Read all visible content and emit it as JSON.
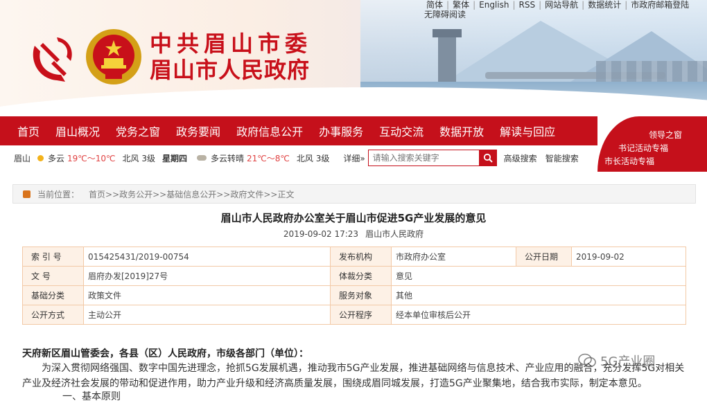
{
  "toplinks": {
    "items": [
      "简体",
      "繁体",
      "English",
      "RSS",
      "网站导航",
      "数据统计",
      "市政府邮箱登陆"
    ],
    "accessibility": "无障碍阅读"
  },
  "header": {
    "line1": "中共眉山市委",
    "line2": "眉山市人民政府"
  },
  "nav": {
    "items": [
      "首页",
      "眉山概况",
      "党务之窗",
      "政务要闻",
      "政府信息公开",
      "办事服务",
      "互动交流",
      "数据开放",
      "解读与回应"
    ]
  },
  "side_links": [
    "领导之窗",
    "书记活动专福",
    "市长活动专福"
  ],
  "weather": {
    "city": "眉山",
    "today": {
      "cond": "多云",
      "temp": "19℃～10℃",
      "wind": "北风 3级"
    },
    "day": "星期四",
    "tomorrow": {
      "cond": "多云转晴",
      "temp": "21℃～8℃",
      "wind": "北风 3级"
    },
    "detail": "详细»"
  },
  "search": {
    "placeholder": "请输入搜索关键字",
    "advanced": "高级搜索",
    "smart": "智能搜索"
  },
  "breadcrumb": {
    "label": "当前位置：",
    "path": "首页>>政务公开>>基础信息公开>>政府文件>>正文"
  },
  "article": {
    "title": "眉山市人民政府办公室关于眉山市促进5G产业发展的意见",
    "date": "2019-09-02 17:23",
    "source": "眉山市人民政府"
  },
  "info_table": [
    [
      [
        "索  引  号",
        "015425431/2019-00754"
      ],
      [
        "发布机构",
        "市政府办公室"
      ],
      [
        "公开日期",
        "2019-09-02"
      ]
    ],
    [
      [
        "文      号",
        "眉府办发[2019]27号"
      ],
      [
        "体裁分类",
        "意见"
      ]
    ],
    [
      [
        "基础分类",
        "政策文件"
      ],
      [
        "服务对象",
        "其他"
      ]
    ],
    [
      [
        "公开方式",
        "主动公开"
      ],
      [
        "公开程序",
        "经本单位审核后公开"
      ]
    ]
  ],
  "body": {
    "salute": "天府新区眉山管委会，各县（区）人民政府，市级各部门（单位）：",
    "para1": "为深入贯彻网络强国、数字中国先进理念，抢抓5G发展机遇，推动我市5G产业发展，推进基础网络与信息技术、产业应用的融合，充分发挥5G对相关产业及经济社会发展的带动和促进作用，助力产业升级和经济高质量发展，围绕成眉同城发展，打造5G产业聚集地，结合我市实际，制定本意见。",
    "para2": "一、基本原则"
  },
  "watermark": "5G产业圈",
  "colors": {
    "brand_red": "#c5101b",
    "table_border": "#f2c9a6",
    "table_key_bg": "#fdf1e6"
  }
}
